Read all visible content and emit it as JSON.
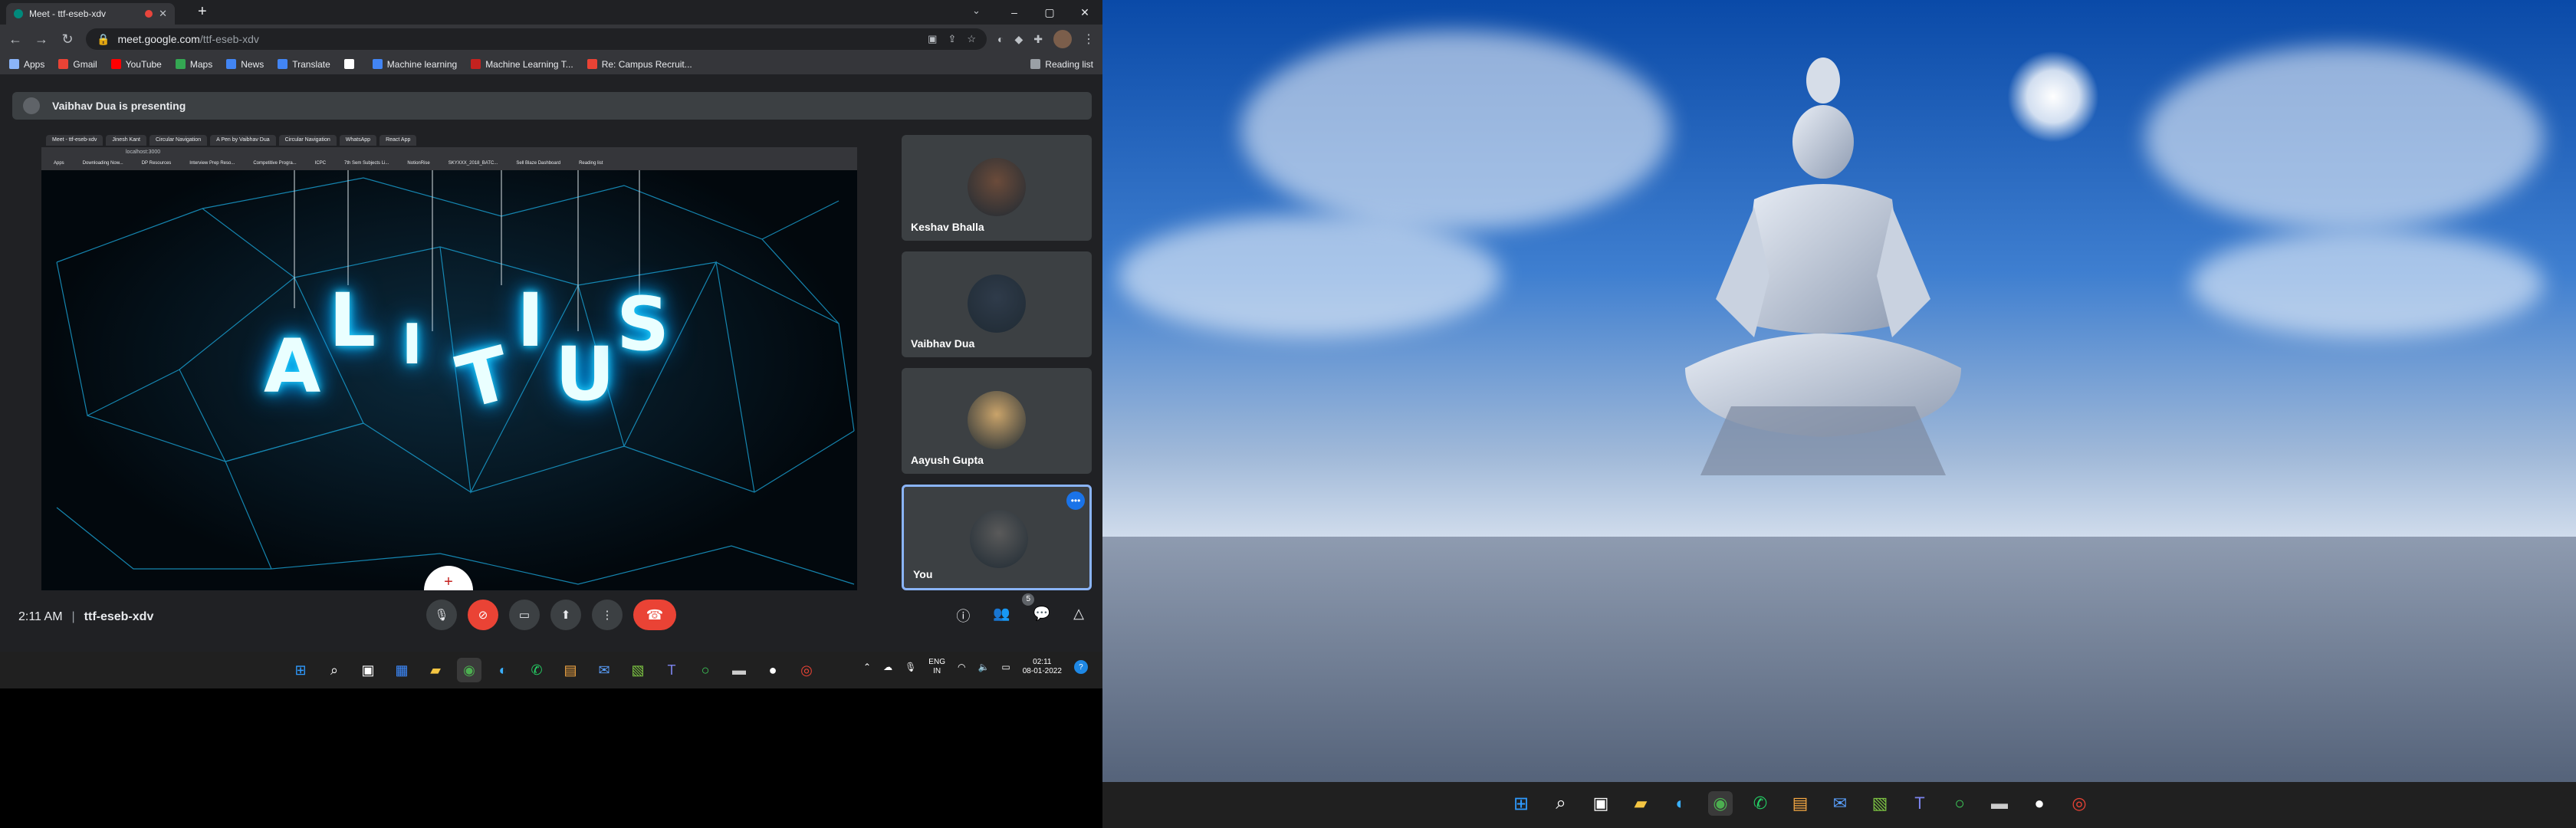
{
  "browser": {
    "tab_title": "Meet - ttf-eseb-xdv",
    "new_tab": "+",
    "url_host": "meet.google.com",
    "url_path": "/ttf-eseb-xdv",
    "window_controls": {
      "minimize": "–",
      "maximize": "▢",
      "close": "✕"
    }
  },
  "bookmarks": [
    {
      "label": "Apps",
      "color": "#8ab4f8"
    },
    {
      "label": "Gmail",
      "color": "#ea4335"
    },
    {
      "label": "YouTube",
      "color": "#ff0000"
    },
    {
      "label": "Maps",
      "color": "#34a853"
    },
    {
      "label": "News",
      "color": "#4285f4"
    },
    {
      "label": "Translate",
      "color": "#4285f4"
    },
    {
      "label": "",
      "color": "#ffffff"
    },
    {
      "label": "Machine learning",
      "color": "#4285f4"
    },
    {
      "label": "Machine Learning T...",
      "color": "#c5221f"
    },
    {
      "label": "Re: Campus Recruit...",
      "color": "#ea4335"
    }
  ],
  "reading_list": "Reading list",
  "meet": {
    "presenting_banner": "Vaibhav Dua is presenting",
    "presentation": {
      "inner_tabs": [
        "Meet - ttf-eseb-xdv",
        "Jinesh Kant",
        "Circular Navigation",
        "A Pen by Vaibhav Dua",
        "Circular Navigation",
        "WhatsApp",
        "React App"
      ],
      "inner_url": "localhost:3000",
      "inner_bookmarks": [
        "Apps",
        "Downloading Now...",
        "DP Resources",
        "Interview Prep Reso...",
        "Competitive Progra...",
        "ICPC",
        "7th Sem Subjects Li...",
        "NotionRise",
        "SKYXXX_2018_BATC...",
        "Sell Blaze Dashboard",
        "Reading list"
      ],
      "letters": [
        "A",
        "L",
        "I",
        "T",
        "I",
        "U",
        "S"
      ]
    },
    "participants": [
      {
        "name": "Keshav Bhalla",
        "avatar_color": "#6b4b3a"
      },
      {
        "name": "Vaibhav Dua",
        "avatar_color": "#2f3b4a"
      },
      {
        "name": "Aayush Gupta",
        "avatar_color": "#c9a36a"
      },
      {
        "name": "You",
        "avatar_color": "#5a5a5a",
        "more": "•••"
      }
    ],
    "time": "2:11 AM",
    "separator": "|",
    "meeting_code": "ttf-eseb-xdv",
    "people_count": "5",
    "add_symbol": "+"
  },
  "taskbar": {
    "lang_top": "ENG",
    "lang_bottom": "IN",
    "clock_time": "02:11",
    "clock_date": "08-01-2022",
    "notification": "?"
  }
}
